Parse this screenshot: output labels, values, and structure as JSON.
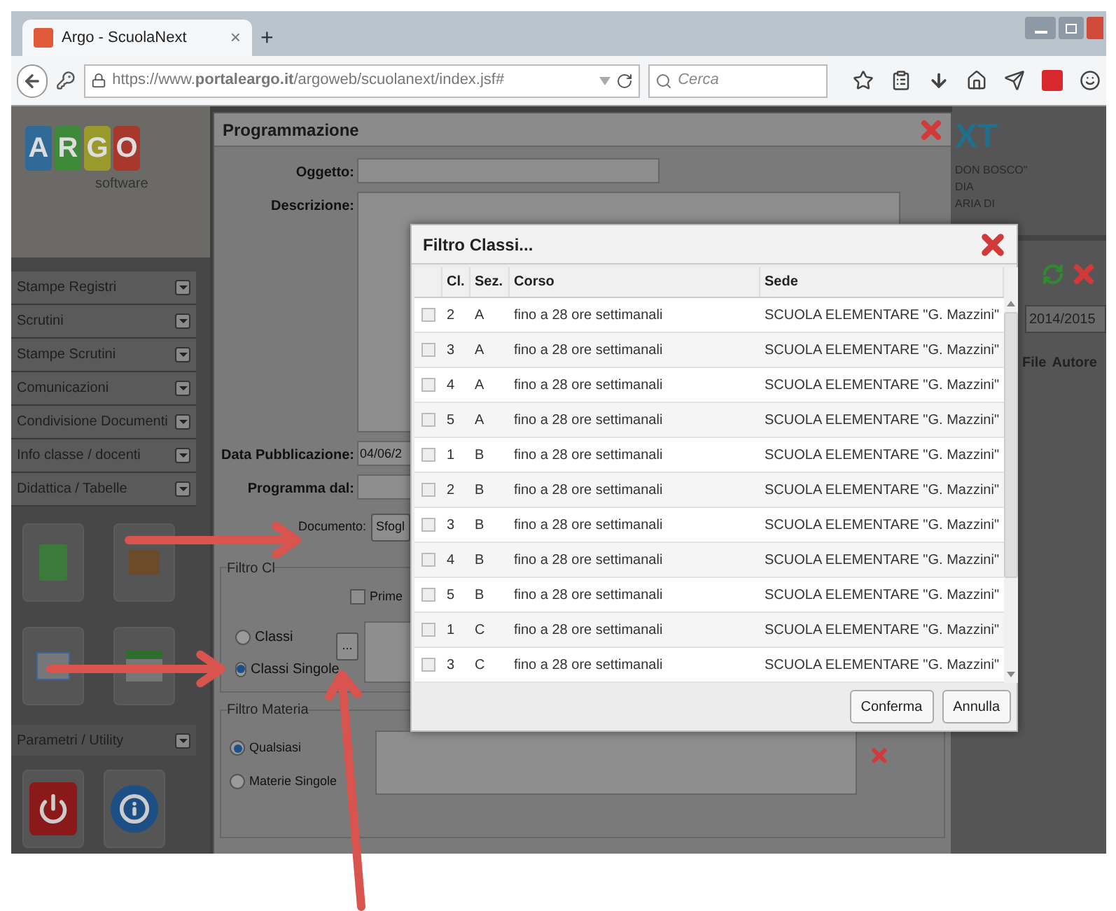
{
  "browser": {
    "tab": {
      "title": "Argo - ScuolaNext",
      "close": "×"
    },
    "new_tab": "+",
    "url": "https://www.**portaleargo.it**/argoweb/scuolanext/index.jsf#",
    "search": {
      "placeholder": "Cerca"
    }
  },
  "sidebar": {
    "logo": {
      "letters": [
        {
          "text": "A",
          "color": "#2f6a98"
        },
        {
          "text": "R",
          "color": "#3f8a3a"
        },
        {
          "text": "G",
          "color": "#9a9a2c"
        },
        {
          "text": "O",
          "color": "#a8382c"
        }
      ],
      "subtitle": "software"
    },
    "menu": [
      {
        "label": "Stampe Registri"
      },
      {
        "label": "Scrutini"
      },
      {
        "label": "Stampe Scrutini"
      },
      {
        "label": "Comunicazioni"
      },
      {
        "label": "Condivisione Documenti"
      },
      {
        "label": "Info classe / docenti"
      },
      {
        "label": "Didattica / Tabelle"
      }
    ],
    "section": "Parametri / Utility"
  },
  "background_app": {
    "brand": "XT",
    "school_lines": [
      "DON BOSCO\"",
      "DIA",
      "ARIA DI"
    ],
    "year": "2014/2015",
    "columns": [
      "File",
      "Autore"
    ]
  },
  "programmazione": {
    "title": "Programmazione",
    "fields": [
      {
        "kind": "text",
        "label": "Oggetto:"
      },
      {
        "kind": "textarea",
        "label": "Descrizione:"
      },
      {
        "kind": "text",
        "label": "Data Pubblicazione:",
        "value": "04/06/2"
      },
      {
        "kind": "text",
        "label": "Programma dal:"
      }
    ],
    "document": {
      "label": "Documento:",
      "button": "Sfogl"
    },
    "filtro_classi": {
      "legend": "Filtro Cl",
      "checkbox": {
        "label": "Prime",
        "checked": false
      },
      "options": [
        {
          "label": "Classi",
          "selected": false
        },
        {
          "label": "Classi Singole",
          "selected": true
        }
      ],
      "picker_button": "..."
    },
    "filtro_materia": {
      "legend": "Filtro Materia",
      "options": [
        {
          "label": "Qualsiasi",
          "selected": true
        },
        {
          "label": "Materie Singole",
          "selected": false
        }
      ]
    }
  },
  "filtro_dialog": {
    "title": "Filtro Classi...",
    "columns": [
      "Cl.",
      "Sez.",
      "Corso",
      "Sede"
    ],
    "rows": [
      {
        "checked": false,
        "cells": [
          "2",
          "A",
          "fino a 28 ore settimanali",
          "SCUOLA ELEMENTARE \"G. Mazzini\""
        ]
      },
      {
        "checked": false,
        "cells": [
          "3",
          "A",
          "fino a 28 ore settimanali",
          "SCUOLA ELEMENTARE \"G. Mazzini\""
        ]
      },
      {
        "checked": false,
        "cells": [
          "4",
          "A",
          "fino a 28 ore settimanali",
          "SCUOLA ELEMENTARE \"G. Mazzini\""
        ]
      },
      {
        "checked": false,
        "cells": [
          "5",
          "A",
          "fino a 28 ore settimanali",
          "SCUOLA ELEMENTARE \"G. Mazzini\""
        ]
      },
      {
        "checked": false,
        "cells": [
          "1",
          "B",
          "fino a 28 ore settimanali",
          "SCUOLA ELEMENTARE \"G. Mazzini\""
        ]
      },
      {
        "checked": false,
        "cells": [
          "2",
          "B",
          "fino a 28 ore settimanali",
          "SCUOLA ELEMENTARE \"G. Mazzini\""
        ]
      },
      {
        "checked": false,
        "cells": [
          "3",
          "B",
          "fino a 28 ore settimanali",
          "SCUOLA ELEMENTARE \"G. Mazzini\""
        ]
      },
      {
        "checked": false,
        "cells": [
          "4",
          "B",
          "fino a 28 ore settimanali",
          "SCUOLA ELEMENTARE \"G. Mazzini\""
        ]
      },
      {
        "checked": false,
        "cells": [
          "5",
          "B",
          "fino a 28 ore settimanali",
          "SCUOLA ELEMENTARE \"G. Mazzini\""
        ]
      },
      {
        "checked": false,
        "cells": [
          "1",
          "C",
          "fino a 28 ore settimanali",
          "SCUOLA ELEMENTARE \"G. Mazzini\""
        ]
      },
      {
        "checked": false,
        "cells": [
          "3",
          "C",
          "fino a 28 ore settimanali",
          "SCUOLA ELEMENTARE \"G. Mazzini\""
        ]
      }
    ],
    "buttons": [
      "Conferma",
      "Annulla"
    ]
  }
}
